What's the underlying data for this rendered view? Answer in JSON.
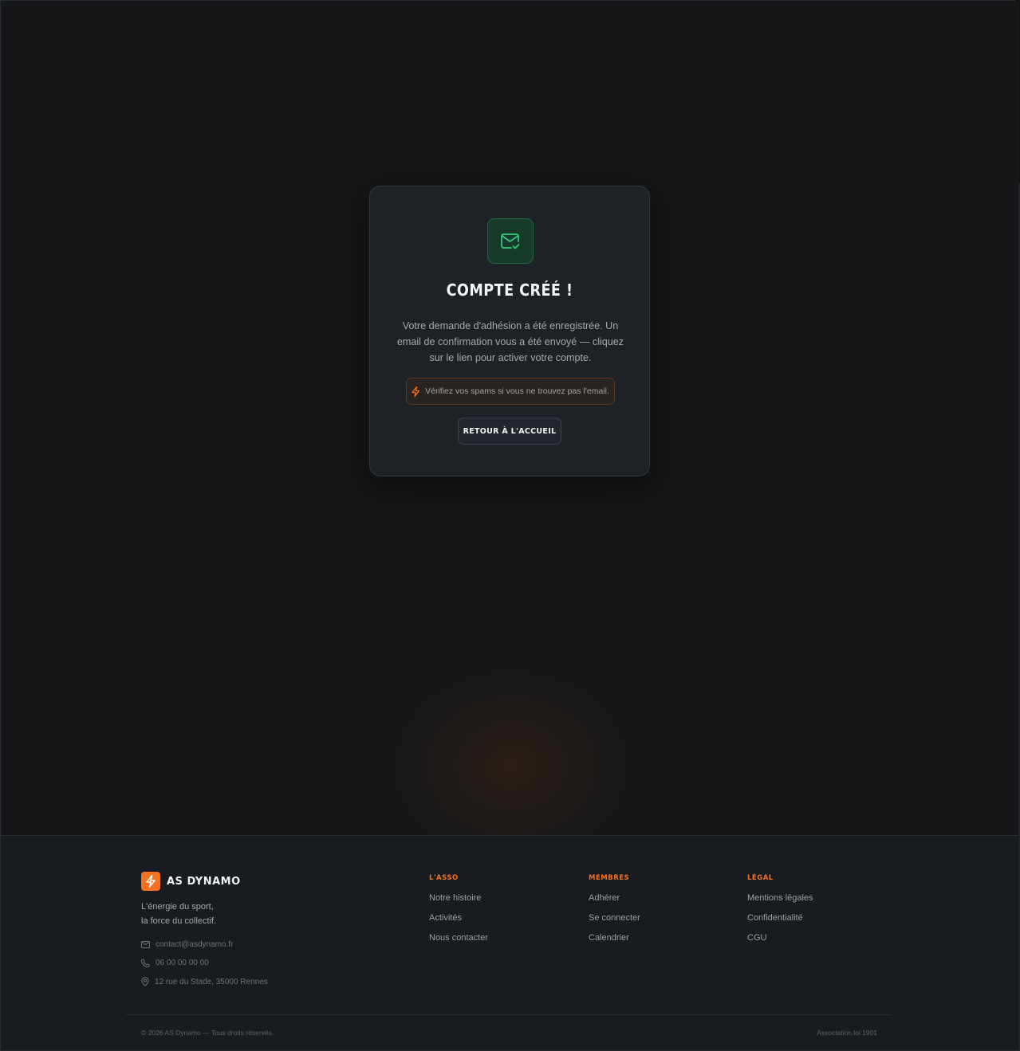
{
  "card": {
    "title": "COMPTE CRÉÉ !",
    "message": "Votre demande d'adhésion a été enregistrée. Un email de confirmation vous a été envoyé — cliquez sur le lien pour activer votre compte.",
    "notice": "Vérifiez vos spams si vous ne trouvez pas l'email.",
    "home_button": "RETOUR À L'ACCUEIL",
    "icon": "mail-check-icon"
  },
  "footer": {
    "brand": "AS DYNAMO",
    "tagline_line1": "L'énergie du sport,",
    "tagline_line2": "la force du collectif.",
    "email": "contact@asdynamo.fr",
    "phone": "06 00 00 00 00",
    "address": "12 rue du Stade, 35000 Rennes",
    "columns": [
      {
        "title": "L'ASSO",
        "links": [
          "Notre histoire",
          "Activités",
          "Nous contacter"
        ]
      },
      {
        "title": "MEMBRES",
        "links": [
          "Adhérer",
          "Se connecter",
          "Calendrier"
        ]
      },
      {
        "title": "LÉGAL",
        "links": [
          "Mentions légales",
          "Confidentialité",
          "CGU"
        ]
      }
    ],
    "copyright": "© 2026 AS Dynamo — Tous droits réservés",
    "association": "Association loi 1901"
  },
  "colors": {
    "accent": "#f47221",
    "success": "#22c55e",
    "background": "#151719"
  }
}
